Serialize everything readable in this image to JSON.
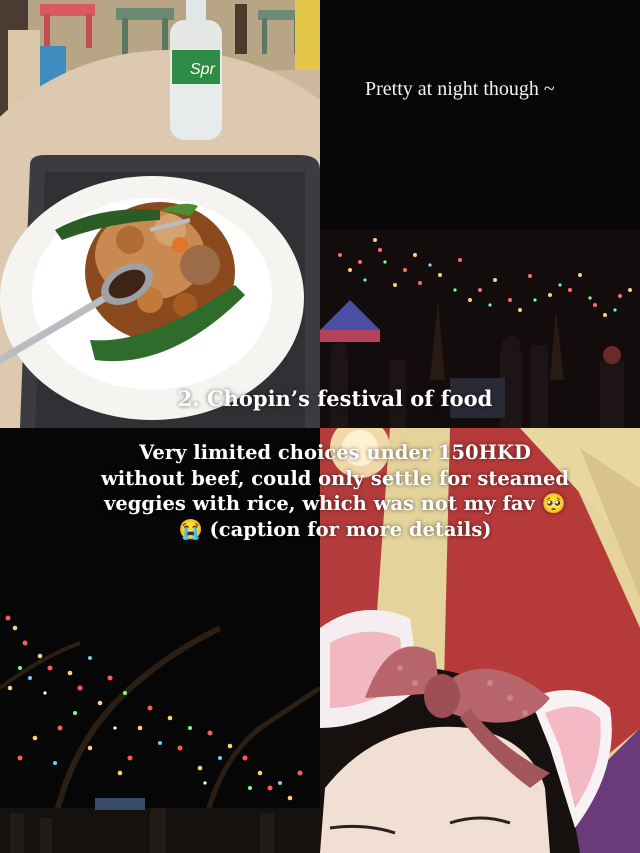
{
  "captions": {
    "night_caption": "Pretty at night though ~",
    "section_title": "2. Chopin’s festival of food",
    "main_caption": "Very limited choices under 150HKD without beef, could only settle for steamed veggies with rice, which was not my fav 🥺😭 (caption for more details)"
  },
  "bottle_label": "Spr",
  "colors": {
    "background": "#000000",
    "text": "#ffffff",
    "tent_red": "#b53b3b",
    "tent_yellow": "#e6d497",
    "bow_pink": "#b8656a",
    "table_wood": "#d9c7ae",
    "tray_gray": "#3b3d40"
  },
  "icons": {
    "panels": [
      "food-photo",
      "night-lights-photo",
      "night-trees-photo",
      "selfie-tent-photo"
    ]
  }
}
